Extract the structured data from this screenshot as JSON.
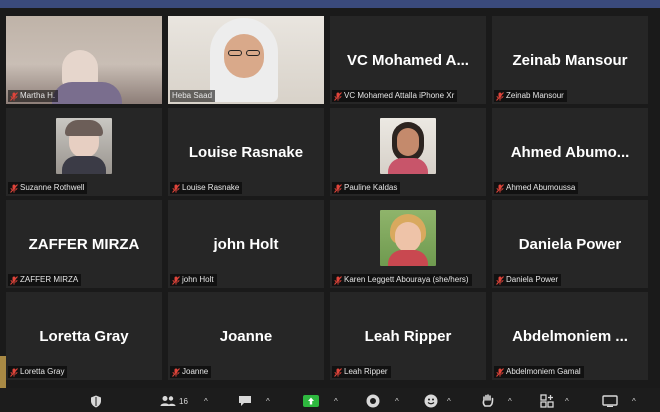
{
  "participants": [
    {
      "label": "Martha H.",
      "big": "",
      "video": "martha",
      "muted": true
    },
    {
      "label": "Heba Saad",
      "big": "",
      "video": "heba",
      "muted": false,
      "active": true
    },
    {
      "label": "VC Mohamed Attalla iPhone Xr",
      "big": "VC Mohamed A...",
      "video": "",
      "muted": true
    },
    {
      "label": "Zeinab Mansour",
      "big": "Zeinab Mansour",
      "video": "",
      "muted": true
    },
    {
      "label": "Suzanne Rothwell",
      "big": "",
      "video": "suzanne",
      "muted": true
    },
    {
      "label": "Louise Rasnake",
      "big": "Louise Rasnake",
      "video": "",
      "muted": true
    },
    {
      "label": "Pauline Kaldas",
      "big": "",
      "video": "pauline",
      "muted": true
    },
    {
      "label": "Ahmed Abumoussa",
      "big": "Ahmed  Abumo...",
      "video": "",
      "muted": true
    },
    {
      "label": "ZAFFER MIRZA",
      "big": "ZAFFER MIRZA",
      "video": "",
      "muted": true
    },
    {
      "label": "john Holt",
      "big": "john Holt",
      "video": "",
      "muted": true
    },
    {
      "label": "Karen Leggett Abouraya (she/hers)",
      "big": "",
      "video": "karen",
      "muted": true
    },
    {
      "label": "Daniela Power",
      "big": "Daniela Power",
      "video": "",
      "muted": true
    },
    {
      "label": "Loretta Gray",
      "big": "Loretta Gray",
      "video": "",
      "muted": true
    },
    {
      "label": "Joanne",
      "big": "Joanne",
      "video": "",
      "muted": true
    },
    {
      "label": "Leah Ripper",
      "big": "Leah Ripper",
      "video": "",
      "muted": true
    },
    {
      "label": "Abdelmoniem Gamal",
      "big": "Abdelmoniem ...",
      "video": "",
      "muted": true
    }
  ],
  "toolbar": {
    "participants_count": "16"
  },
  "colors": {
    "active_border": "#c6e04a",
    "muted_mic": "#e0443a",
    "share_green": "#2eb83f"
  }
}
